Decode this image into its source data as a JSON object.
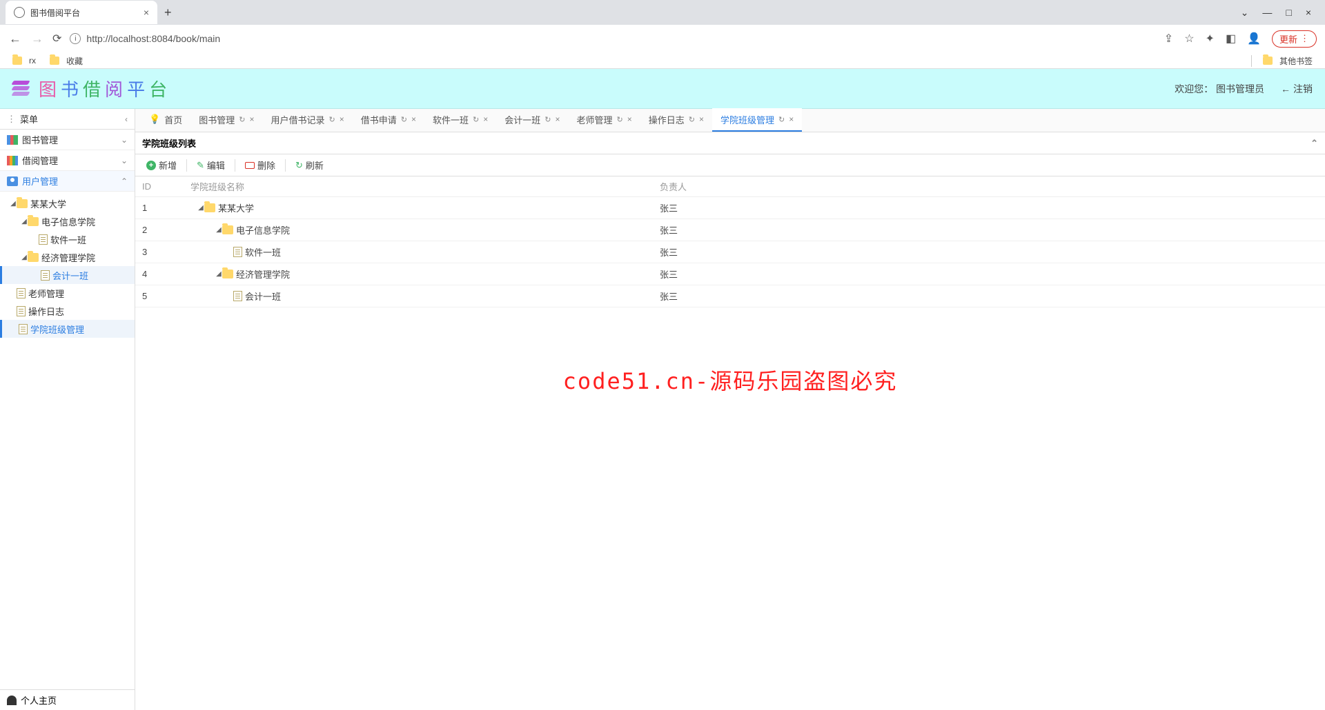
{
  "browser": {
    "tab_title": "图书借阅平台",
    "url": "http://localhost:8084/book/main",
    "update_label": "更新",
    "bookmarks": {
      "rx": "rx",
      "fav": "收藏",
      "other": "其他书签"
    }
  },
  "header": {
    "title_chars": [
      "图",
      "书",
      "借",
      "阅",
      "平",
      "台"
    ],
    "welcome": "欢迎您：",
    "role": "图书管理员",
    "logout": "注销"
  },
  "sidebar": {
    "menu_label": "菜单",
    "groups": {
      "books": "图书管理",
      "borrow": "借阅管理",
      "user": "用户管理"
    },
    "tree": {
      "root": "某某大学",
      "dept1": "电子信息学院",
      "class1": "软件一班",
      "dept2": "经济管理学院",
      "class2": "会计一班"
    },
    "leaf1": "老师管理",
    "leaf2": "操作日志",
    "leaf3": "学院班级管理",
    "personal": "个人主页"
  },
  "tabs": [
    {
      "label": "首页",
      "home": true
    },
    {
      "label": "图书管理"
    },
    {
      "label": "用户借书记录"
    },
    {
      "label": "借书申请"
    },
    {
      "label": "软件一班"
    },
    {
      "label": "会计一班"
    },
    {
      "label": "老师管理"
    },
    {
      "label": "操作日志"
    },
    {
      "label": "学院班级管理",
      "active": true
    }
  ],
  "panel": {
    "title": "学院班级列表",
    "toolbar": {
      "add": "新增",
      "edit": "编辑",
      "del": "删除",
      "refresh": "刷新"
    },
    "columns": {
      "id": "ID",
      "name": "学院班级名称",
      "owner": "负责人"
    },
    "rows": [
      {
        "id": "1",
        "name": "某某大学",
        "owner": "张三",
        "indent": 0,
        "type": "folder",
        "exp": true
      },
      {
        "id": "2",
        "name": "电子信息学院",
        "owner": "张三",
        "indent": 1,
        "type": "folder",
        "exp": true
      },
      {
        "id": "3",
        "name": "软件一班",
        "owner": "张三",
        "indent": 2,
        "type": "page"
      },
      {
        "id": "4",
        "name": "经济管理学院",
        "owner": "张三",
        "indent": 1,
        "type": "folder",
        "exp": true
      },
      {
        "id": "5",
        "name": "会计一班",
        "owner": "张三",
        "indent": 2,
        "type": "page"
      }
    ]
  },
  "watermark": "code51.cn-源码乐园盗图必究"
}
